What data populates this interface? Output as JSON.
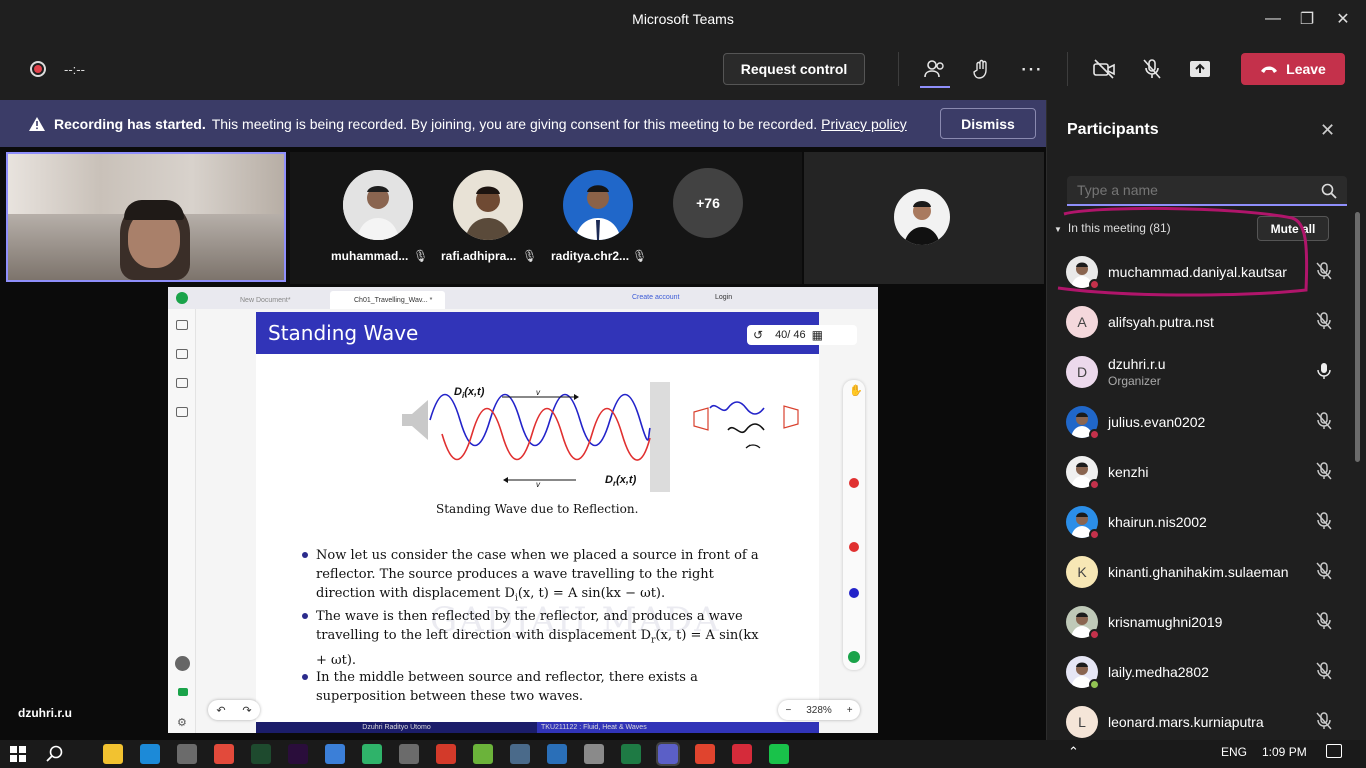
{
  "window": {
    "title": "Microsoft Teams"
  },
  "toolbar": {
    "timer": "--:--",
    "request_control": "Request control",
    "leave": "Leave"
  },
  "banner": {
    "bold": "Recording has started.",
    "text": "This meeting is being recorded. By joining, you are giving consent for this meeting to be recorded.",
    "link": "Privacy policy",
    "dismiss": "Dismiss"
  },
  "gallery": {
    "participants": [
      {
        "name": "muhammad..."
      },
      {
        "name": "rafi.adhipra..."
      },
      {
        "name": "raditya.chr2..."
      }
    ],
    "more": "+76"
  },
  "presenter_label": "dzuhri.r.u",
  "viewer": {
    "tabs": [
      "New Document*",
      "Ch01_Travelling_Wav... *"
    ],
    "create_account": "Create account",
    "login": "Login",
    "page": "40/ 46",
    "zoom": "328%"
  },
  "slide": {
    "title": "Standing Wave",
    "label_di": "D",
    "label_di_sub": "i",
    "label_di_args": "(x,t)",
    "label_dr": "D",
    "label_dr_sub": "r",
    "label_dr_args": "(x,t)",
    "v": "v",
    "caption": "Standing Wave due to Reflection.",
    "bullets": [
      "Now let us consider the case when we placed a source in front of a reflector. The source produces a wave travelling to the right direction with displacement D",
      "The wave is then reflected by the reflector, and produces a wave travelling to the left direction with displacement",
      "In the middle between source and reflector, there exists a superposition between these two waves."
    ],
    "b1_tail": "(x, t) = A sin(kx − ωt).",
    "b2_tail": "D",
    "b2_tail2": "(x, t) = A sin(kx + ωt).",
    "watermark": "GADJAH MADA",
    "footer_left": "Dzuhri Radityo Utomo",
    "footer_right": "TKU211122 : Fluid, Heat & Waves"
  },
  "participants_panel": {
    "title": "Participants",
    "search_placeholder": "Type a name",
    "section": "In this meeting (81)",
    "mute_all": "Mute all",
    "people": [
      {
        "name": "muchammad.daniyal.kautsar",
        "initial": "",
        "sub": "",
        "mic": "muted"
      },
      {
        "name": "alifsyah.putra.nst",
        "initial": "A",
        "sub": "",
        "mic": "muted"
      },
      {
        "name": "dzuhri.r.u",
        "initial": "D",
        "sub": "Organizer",
        "mic": "on"
      },
      {
        "name": "julius.evan0202",
        "initial": "",
        "sub": "",
        "mic": "muted"
      },
      {
        "name": "kenzhi",
        "initial": "",
        "sub": "",
        "mic": "muted"
      },
      {
        "name": "khairun.nis2002",
        "initial": "",
        "sub": "",
        "mic": "muted"
      },
      {
        "name": "kinanti.ghanihakim.sulaeman",
        "initial": "K",
        "sub": "",
        "mic": "muted"
      },
      {
        "name": "krisnamughni2019",
        "initial": "",
        "sub": "",
        "mic": "muted"
      },
      {
        "name": "laily.medha2802",
        "initial": "",
        "sub": "",
        "mic": "muted"
      },
      {
        "name": "leonard.mars.kurniaputra",
        "initial": "L",
        "sub": "",
        "mic": "muted"
      }
    ]
  },
  "taskbar": {
    "lang": "ENG",
    "time": "1:09 PM"
  },
  "colors": {
    "accent": "#3134b8",
    "leave": "#c4314b",
    "banner": "#3b3c67",
    "annotation": "#b0156b"
  }
}
